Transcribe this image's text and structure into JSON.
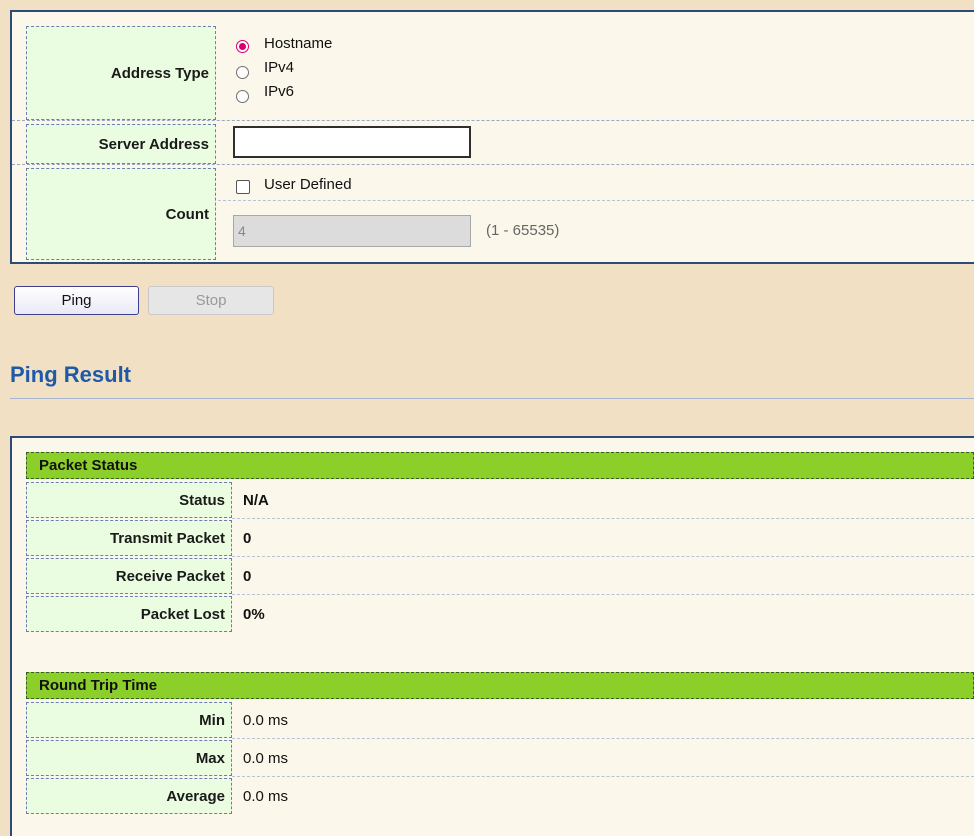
{
  "ping_form": {
    "address_type_label": "Address Type",
    "address_options": [
      {
        "label": "Hostname",
        "selected": true
      },
      {
        "label": "IPv4",
        "selected": false
      },
      {
        "label": "IPv6",
        "selected": false
      }
    ],
    "server_address_label": "Server Address",
    "server_address_value": "",
    "count_label": "Count",
    "user_defined_label": "User Defined",
    "user_defined_checked": false,
    "count_value": "4",
    "count_range": "(1 - 65535)"
  },
  "buttons": {
    "ping_label": "Ping",
    "stop_label": "Stop"
  },
  "result": {
    "title": "Ping Result",
    "packet_status_header": "Packet Status",
    "packet_rows": [
      {
        "label": "Status",
        "value": "N/A"
      },
      {
        "label": "Transmit Packet",
        "value": "0"
      },
      {
        "label": "Receive Packet",
        "value": "0"
      },
      {
        "label": "Packet Lost",
        "value": "0%"
      }
    ],
    "rtt_header": "Round Trip Time",
    "rtt_rows": [
      {
        "label": "Min",
        "value": "0.0 ms"
      },
      {
        "label": "Max",
        "value": "0.0 ms"
      },
      {
        "label": "Average",
        "value": "0.0 ms"
      }
    ]
  },
  "colors": {
    "accent_radio": "#d5006d",
    "header_green": "#8ccf2a",
    "label_green": "#eafde0",
    "title_blue": "#1e5aa8"
  }
}
